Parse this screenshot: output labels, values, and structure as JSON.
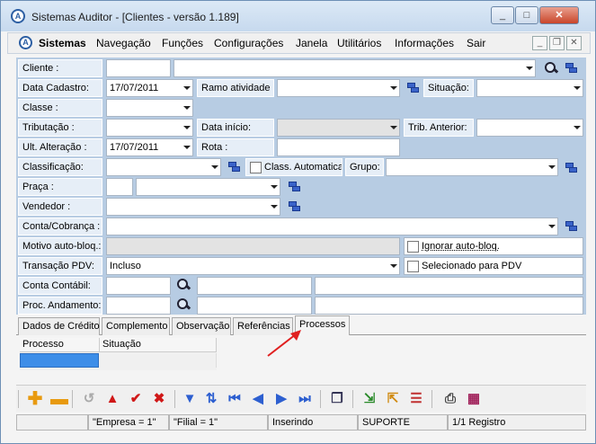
{
  "window": {
    "title": "Sistemas Auditor - [Clientes - versão 1.189]"
  },
  "menu": {
    "app_name": "Sistemas",
    "items": [
      "Navegação",
      "Funções",
      "Configurações",
      "Janela",
      "Utilitários",
      "Informações",
      "Sair"
    ]
  },
  "form": {
    "cliente": {
      "label": "Cliente :",
      "code": "",
      "name": ""
    },
    "data_cadastro": {
      "label": "Data Cadastro:",
      "value": "17/07/2011"
    },
    "ramo_atividade": {
      "label": "Ramo atividade :",
      "value": ""
    },
    "situacao": {
      "label": "Situação:",
      "value": ""
    },
    "classe": {
      "label": "Classe :",
      "value": ""
    },
    "tributacao": {
      "label": "Tributação :",
      "value": ""
    },
    "data_inicio": {
      "label": "Data início:",
      "value": ""
    },
    "trib_anterior": {
      "label": "Trib. Anterior:",
      "value": ""
    },
    "ult_alteracao": {
      "label": "Ult. Alteração :",
      "value": "17/07/2011"
    },
    "rota": {
      "label": "Rota :",
      "value": ""
    },
    "classificacao": {
      "label": "Classificação:",
      "value": ""
    },
    "class_automatica": {
      "label": "Class. Automatica",
      "checked": false
    },
    "grupo": {
      "label": "Grupo:",
      "value": ""
    },
    "praca": {
      "label": "Praça :",
      "code": "",
      "value": ""
    },
    "vendedor": {
      "label": "Vendedor :",
      "value": ""
    },
    "conta_cobranca": {
      "label": "Conta/Cobrança :",
      "value": ""
    },
    "motivo_auto_bloq": {
      "label": "Motivo auto-bloq.:",
      "value": ""
    },
    "ignorar_auto_bloq": {
      "label": "Ignorar auto-bloq.",
      "checked": false
    },
    "transacao_pdv": {
      "label": "Transação PDV:",
      "value": "Incluso"
    },
    "selecionado_pdv": {
      "label": "Selecionado para PDV",
      "checked": false
    },
    "conta_contabil": {
      "label": "Conta Contábil:",
      "value": ""
    },
    "proc_andamento": {
      "label": "Proc. Andamento:",
      "value": ""
    }
  },
  "tabs": [
    "Dados de Crédito",
    "Complemento",
    "Observação",
    "Referências",
    "Processos"
  ],
  "active_tab": "Processos",
  "grid": {
    "columns": [
      "Processo",
      "Situação"
    ]
  },
  "status": {
    "empresa": "\"Empresa = 1\"",
    "filial": "\"Filial = 1\"",
    "mode": "Inserindo",
    "user": "SUPORTE",
    "records": "1/1 Registro"
  },
  "colors": {
    "form_bg": "#b7cce3",
    "label_bg": "#e6eef7",
    "selection": "#3d8ee8",
    "annotation_arrow": "#e02020"
  }
}
